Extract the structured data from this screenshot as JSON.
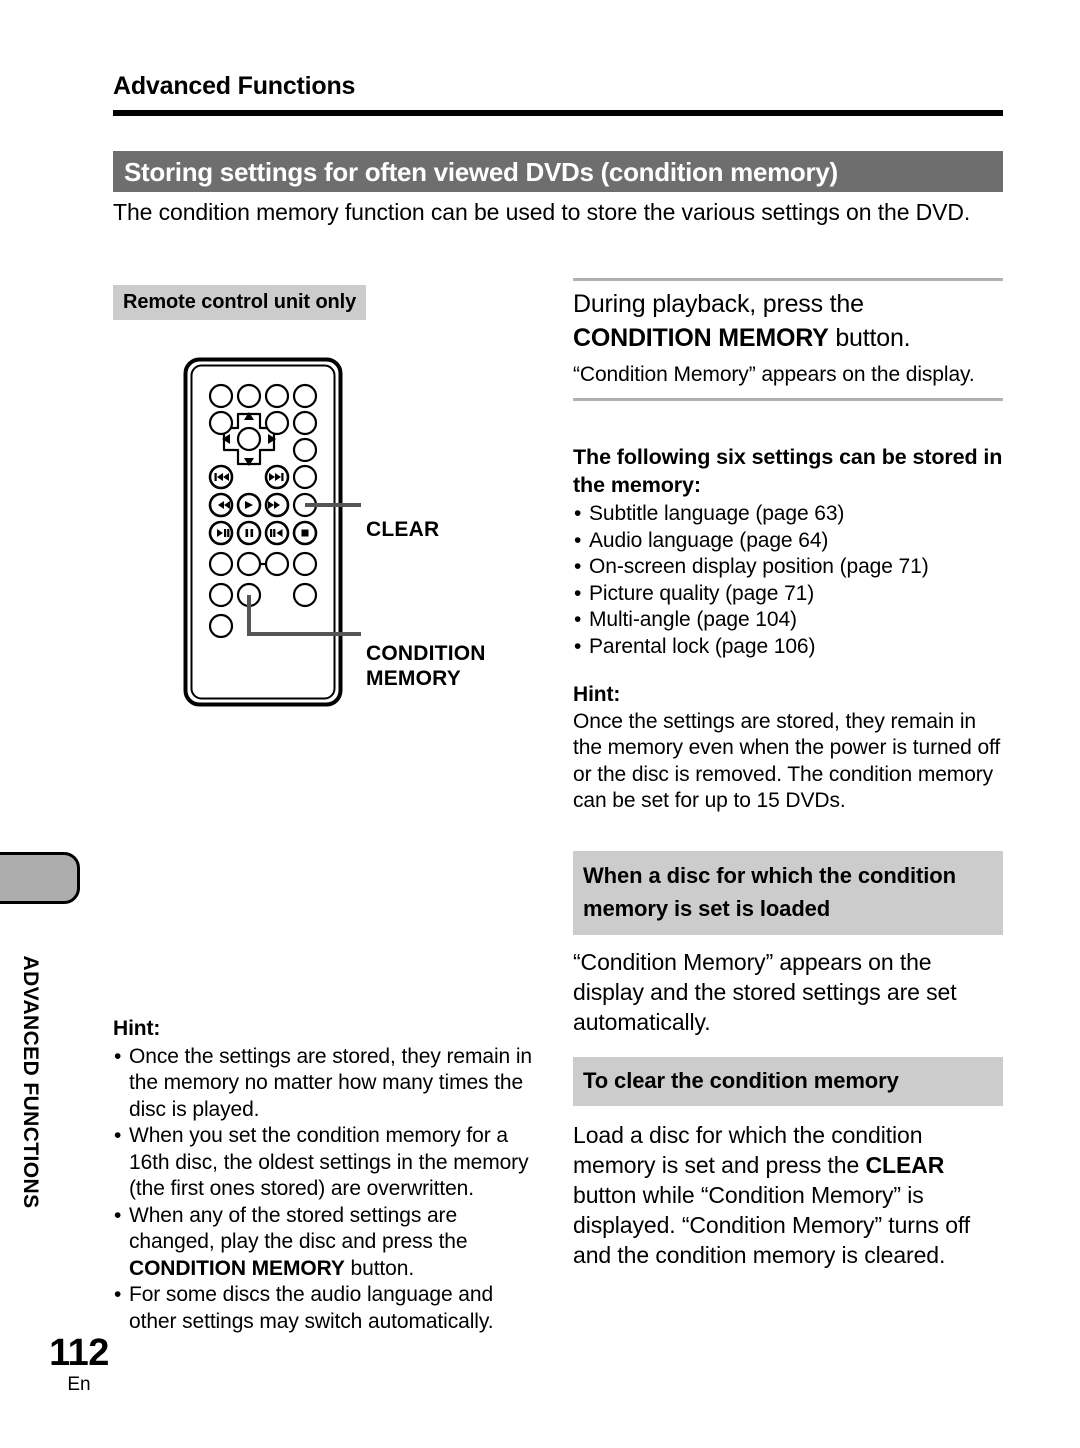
{
  "side_tab": {
    "label": "ADVANCED FUNCTIONS"
  },
  "header": {
    "title": "Advanced Functions"
  },
  "section": {
    "banner_title": "Storing settings for often viewed DVDs (condition memory)"
  },
  "intro": {
    "text": "The condition memory function can be used to store the various settings on the DVD."
  },
  "left": {
    "remote_badge": "Remote control unit only",
    "callouts": {
      "clear": "CLEAR",
      "condition_memory_line1": "CONDITION",
      "condition_memory_line2": "MEMORY"
    },
    "hint": {
      "title": "Hint:",
      "bullets": [
        "Once the settings are stored, they remain in the memory no matter how many times the disc is played.",
        "When you set the condition memory for a 16th disc, the oldest settings in the memory (the first ones stored) are overwritten.",
        "When any of the stored settings are changed, play the disc and press the ",
        "For some discs the audio language and other settings may switch automatically."
      ],
      "bullet3_bold": "CONDITION MEMORY",
      "bullet3_tail": " button."
    }
  },
  "right": {
    "step_head_plain": "During playback, press the ",
    "step_head_bold": "CONDITION MEMORY",
    "step_head_tail": " button.",
    "step_sub": "“Condition Memory” appears on the display.",
    "settings_title": "The following six settings can be stored in the memory:",
    "settings_list": [
      "Subtitle language (page 63)",
      "Audio language (page 64)",
      "On-screen display position (page 71)",
      "Picture quality (page 71)",
      "Multi-angle (page 104)",
      "Parental lock (page 106)"
    ],
    "hint": {
      "title": "Hint:",
      "text": "Once the settings are stored, they remain in the memory even when the power is turned off or the disc is removed.  The condition memory can be set for up to 15 DVDs."
    },
    "head_loaded": "When a disc for which the condition memory is set is loaded",
    "para_loaded": "“Condition Memory” appears on the display and the stored settings are set automatically.",
    "head_clear": "To clear the condition memory",
    "para_clear_1": "Load a disc for which the condition memory is set and press the ",
    "para_clear_bold": "CLEAR",
    "para_clear_2": " button while “Condition Memory” is displayed.  “Condition Memory” turns off and the condition memory is cleared."
  },
  "footer": {
    "page_number": "112",
    "language_code": "En"
  },
  "colors": {
    "banner_bg": "#6e6e6e",
    "gray_head_bg": "#cccccc",
    "side_tab_bg": "#adadad",
    "rule_gray": "#b0b0b0",
    "text": "#000000"
  }
}
